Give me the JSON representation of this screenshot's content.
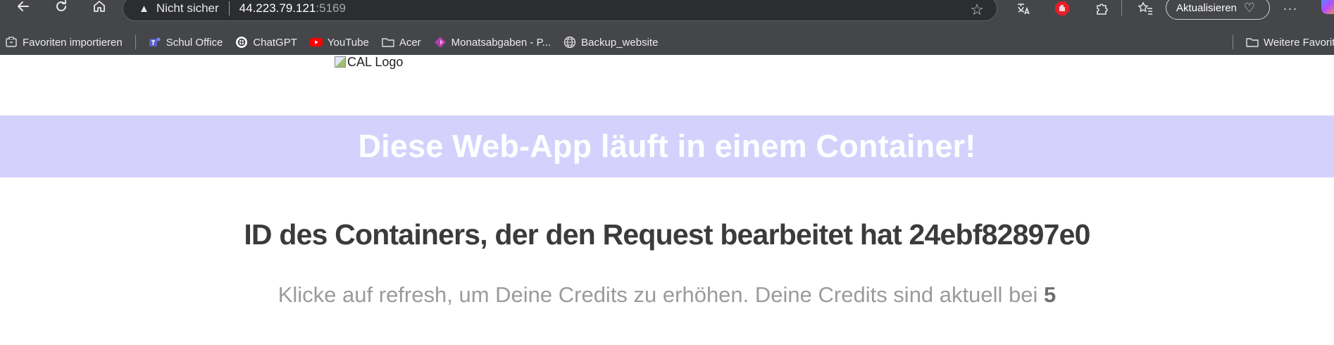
{
  "browser": {
    "address": {
      "security_label": "Nicht sicher",
      "host": "44.223.79.121",
      "port": ":5169"
    },
    "update_button_label": "Aktualisieren",
    "bookmarks": [
      {
        "label": "Favoriten importieren",
        "icon": "import-icon"
      },
      {
        "label": "Schul Office",
        "icon": "teams-icon"
      },
      {
        "label": "ChatGPT",
        "icon": "chatgpt-icon"
      },
      {
        "label": "YouTube",
        "icon": "youtube-icon"
      },
      {
        "label": "Acer",
        "icon": "folder-icon"
      },
      {
        "label": "Monatsabgaben - P...",
        "icon": "powerapps-icon"
      },
      {
        "label": "Backup_website",
        "icon": "globe-icon"
      }
    ],
    "other_favorites_label": "Weitere Favoriten"
  },
  "page": {
    "logo_alt": "CAL Logo",
    "banner_title": "Diese Web-App läuft in einem Container!",
    "container_id_text": "ID des Containers, der den Request bearbeitet hat 24ebf82897e0",
    "credits_text": "Klicke auf refresh, um Deine Credits zu erhöhen. Deine Credits sind aktuell bei ",
    "credits_value": "5"
  },
  "colors": {
    "banner_bg": "#d4d2fd",
    "browser_chrome": "#45464a"
  }
}
